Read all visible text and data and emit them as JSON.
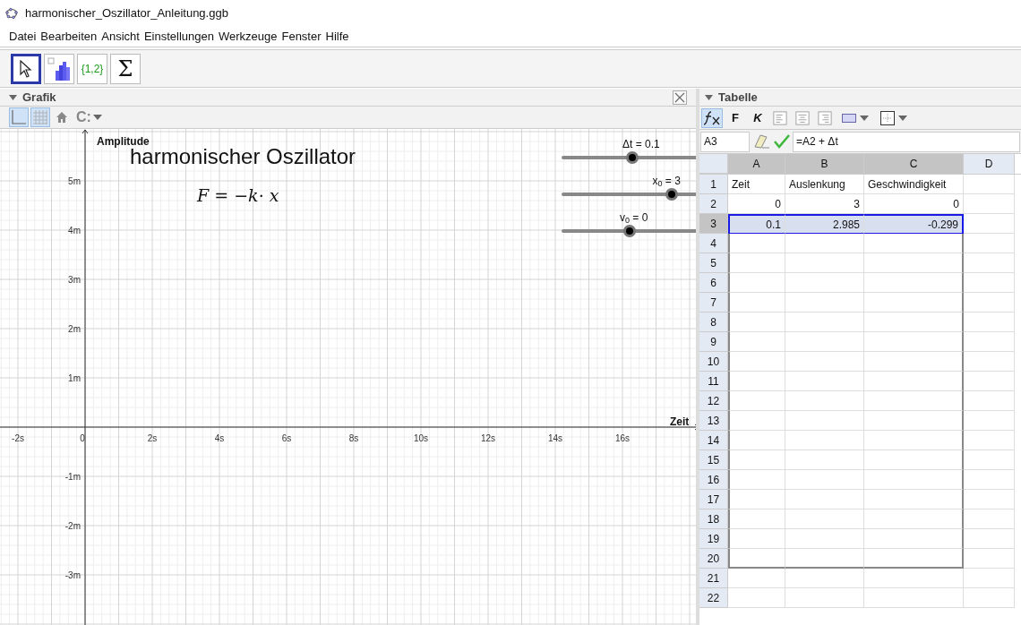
{
  "window": {
    "title": "harmonischer_Oszillator_Anleitung.ggb"
  },
  "menu": [
    "Datei",
    "Bearbeiten",
    "Ansicht",
    "Einstellungen",
    "Werkzeuge",
    "Fenster",
    "Hilfe"
  ],
  "toolbar": [
    {
      "kind": "pointer",
      "selected": true
    },
    {
      "kind": "chart",
      "selected": false
    },
    {
      "kind": "list",
      "label": "{1,2}",
      "selected": false
    },
    {
      "kind": "sum",
      "label": "Σ",
      "selected": false
    }
  ],
  "graphics": {
    "title": "Grafik",
    "tools": [
      {
        "kind": "axes",
        "selected": true
      },
      {
        "kind": "grid",
        "selected": true
      },
      {
        "kind": "home",
        "selected": false
      },
      {
        "kind": "capture",
        "label": "C:",
        "selected": false
      }
    ],
    "heading": "harmonischer Oszillator",
    "formula": "*F* = −*k*· *x*",
    "y_axis_label": "Amplitude",
    "x_axis_label": "Zeit",
    "x_ticks": [
      "-2s",
      "0",
      "2s",
      "4s",
      "6s",
      "8s",
      "10s",
      "12s",
      "14s",
      "16s"
    ],
    "y_ticks": [
      "5m",
      "4m",
      "3m",
      "2m",
      "1m",
      "-1m",
      "-2m",
      "-3m"
    ],
    "sliders": [
      {
        "label": "Δt = 0.1",
        "level": 0.52
      },
      {
        "label": "x$_{0}$ = 3",
        "level": 0.81
      },
      {
        "label": "v$_{0}$ = 0",
        "level": 0.5
      }
    ]
  },
  "spreadsheet": {
    "title": "Tabelle",
    "tools": [
      {
        "kind": "fx",
        "selected": true
      },
      {
        "kind": "bold",
        "label": "F",
        "selected": false
      },
      {
        "kind": "italic",
        "label": "K",
        "selected": false
      },
      {
        "kind": "align-left",
        "selected": false
      },
      {
        "kind": "align-center",
        "selected": false
      },
      {
        "kind": "align-right",
        "selected": false
      },
      {
        "kind": "fill",
        "selected": false
      },
      {
        "kind": "border",
        "selected": false
      }
    ],
    "cell_ref": "A3",
    "formula": "=A2 + Δt",
    "columns": [
      {
        "label": "A",
        "selected": true
      },
      {
        "label": "B",
        "selected": true
      },
      {
        "label": "C",
        "selected": true
      },
      {
        "label": "D",
        "selected": false
      }
    ],
    "rows": [
      {
        "label": "1",
        "selected": false,
        "cells": [
          {
            "text": "Zeit",
            "kind": "text"
          },
          {
            "text": "Auslenkung",
            "kind": "text"
          },
          {
            "text": "Geschwindigkeit",
            "kind": "text"
          }
        ]
      },
      {
        "label": "2",
        "selected": false,
        "cells": [
          {
            "text": "0",
            "kind": "number"
          },
          {
            "text": "3",
            "kind": "number"
          },
          {
            "text": "0",
            "kind": "number"
          }
        ]
      },
      {
        "label": "3",
        "selected": true,
        "cells": [
          {
            "text": "0.1",
            "kind": "number"
          },
          {
            "text": "2.985",
            "kind": "number"
          },
          {
            "text": "-0.299",
            "kind": "number"
          }
        ]
      },
      {
        "label": "4",
        "selected": false
      },
      {
        "label": "5",
        "selected": false
      },
      {
        "label": "6",
        "selected": false
      },
      {
        "label": "7",
        "selected": false
      },
      {
        "label": "8",
        "selected": false
      },
      {
        "label": "9",
        "selected": false
      },
      {
        "label": "10",
        "selected": false
      },
      {
        "label": "11",
        "selected": false
      },
      {
        "label": "12",
        "selected": false
      },
      {
        "label": "13",
        "selected": false
      },
      {
        "label": "14",
        "selected": false
      },
      {
        "label": "15",
        "selected": false
      },
      {
        "label": "16",
        "selected": false
      },
      {
        "label": "17",
        "selected": false
      },
      {
        "label": "18",
        "selected": false
      },
      {
        "label": "19",
        "selected": false
      },
      {
        "label": "20",
        "selected": false
      },
      {
        "label": "21",
        "selected": false
      },
      {
        "label": "22",
        "selected": false
      }
    ]
  }
}
